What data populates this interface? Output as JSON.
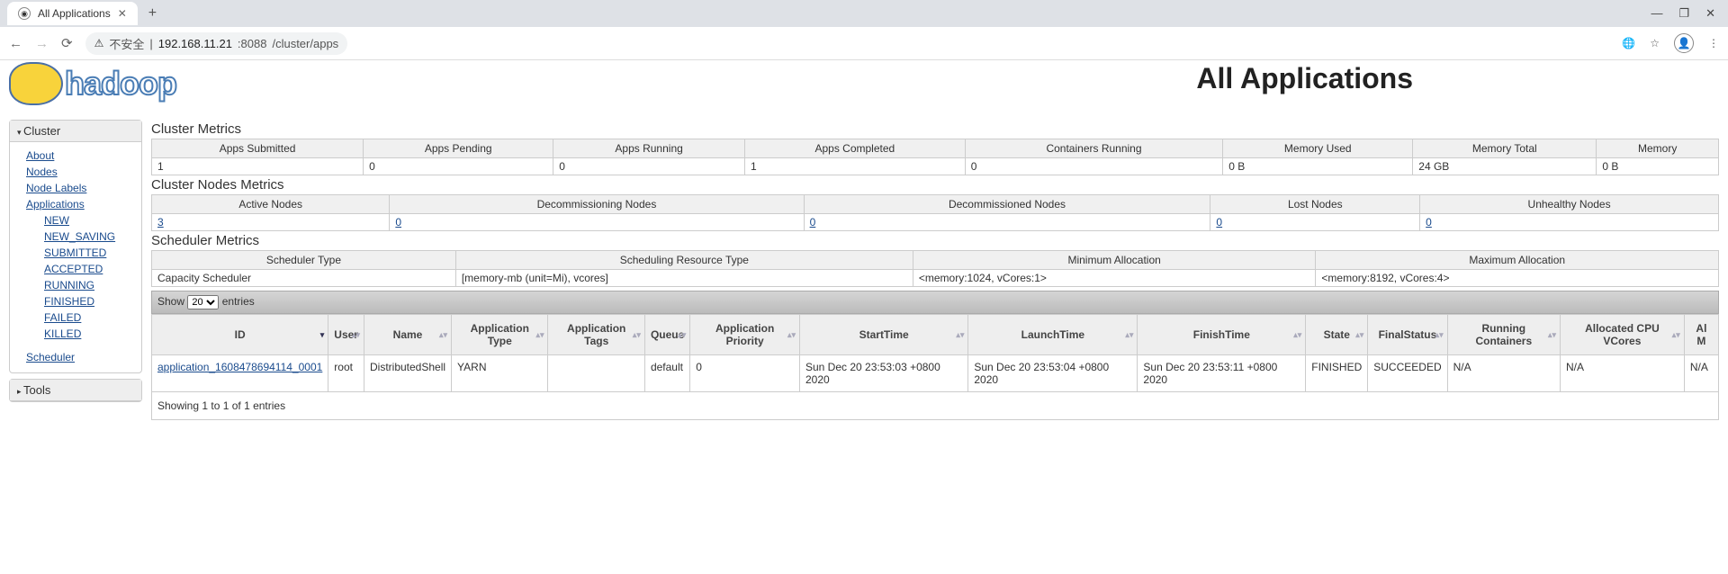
{
  "browser": {
    "tab_title": "All Applications",
    "security_label": "不安全",
    "url_host": "192.168.11.21",
    "url_port": ":8088",
    "url_path": "/cluster/apps"
  },
  "page": {
    "logo_text": "hadoop",
    "title": "All Applications"
  },
  "sidebar": {
    "cluster_header": "Cluster",
    "about": "About",
    "nodes": "Nodes",
    "node_labels": "Node Labels",
    "applications": "Applications",
    "app_states": {
      "new": "NEW",
      "new_saving": "NEW_SAVING",
      "submitted": "SUBMITTED",
      "accepted": "ACCEPTED",
      "running": "RUNNING",
      "finished": "FINISHED",
      "failed": "FAILED",
      "killed": "KILLED"
    },
    "scheduler": "Scheduler",
    "tools_header": "Tools"
  },
  "cluster_metrics": {
    "section": "Cluster Metrics",
    "headers": {
      "submitted": "Apps Submitted",
      "pending": "Apps Pending",
      "running": "Apps Running",
      "completed": "Apps Completed",
      "containers": "Containers Running",
      "mem_used": "Memory Used",
      "mem_total": "Memory Total",
      "mem_res": "Memory"
    },
    "values": {
      "submitted": "1",
      "pending": "0",
      "running": "0",
      "completed": "1",
      "containers": "0",
      "mem_used": "0 B",
      "mem_total": "24 GB",
      "mem_res": "0 B"
    }
  },
  "nodes_metrics": {
    "section": "Cluster Nodes Metrics",
    "headers": {
      "active": "Active Nodes",
      "decommissioning": "Decommissioning Nodes",
      "decommissioned": "Decommissioned Nodes",
      "lost": "Lost Nodes",
      "unhealthy": "Unhealthy Nodes"
    },
    "values": {
      "active": "3",
      "decommissioning": "0",
      "decommissioned": "0",
      "lost": "0",
      "unhealthy": "0"
    }
  },
  "scheduler_metrics": {
    "section": "Scheduler Metrics",
    "headers": {
      "type": "Scheduler Type",
      "resource_type": "Scheduling Resource Type",
      "min_alloc": "Minimum Allocation",
      "max_alloc": "Maximum Allocation"
    },
    "values": {
      "type": "Capacity Scheduler",
      "resource_type": "[memory-mb (unit=Mi), vcores]",
      "min_alloc": "<memory:1024, vCores:1>",
      "max_alloc": "<memory:8192, vCores:4>"
    }
  },
  "datatable": {
    "show_prefix": "Show",
    "show_count": "20",
    "show_suffix": "entries",
    "info": "Showing 1 to 1 of 1 entries",
    "headers": {
      "id": "ID",
      "user": "User",
      "name": "Name",
      "app_type": "Application Type",
      "app_tags": "Application Tags",
      "queue": "Queue",
      "priority": "Application Priority",
      "start": "StartTime",
      "launch": "LaunchTime",
      "finish": "FinishTime",
      "state": "State",
      "final": "FinalStatus",
      "running_containers": "Running Containers",
      "cpu": "Allocated CPU VCores",
      "mem": "Al M"
    },
    "row": {
      "id": "application_1608478694114_0001",
      "user": "root",
      "name": "DistributedShell",
      "app_type": "YARN",
      "app_tags": "",
      "queue": "default",
      "priority": "0",
      "start": "Sun Dec 20 23:53:03 +0800 2020",
      "launch": "Sun Dec 20 23:53:04 +0800 2020",
      "finish": "Sun Dec 20 23:53:11 +0800 2020",
      "state": "FINISHED",
      "final": "SUCCEEDED",
      "running_containers": "N/A",
      "cpu": "N/A",
      "mem": "N/A"
    }
  }
}
